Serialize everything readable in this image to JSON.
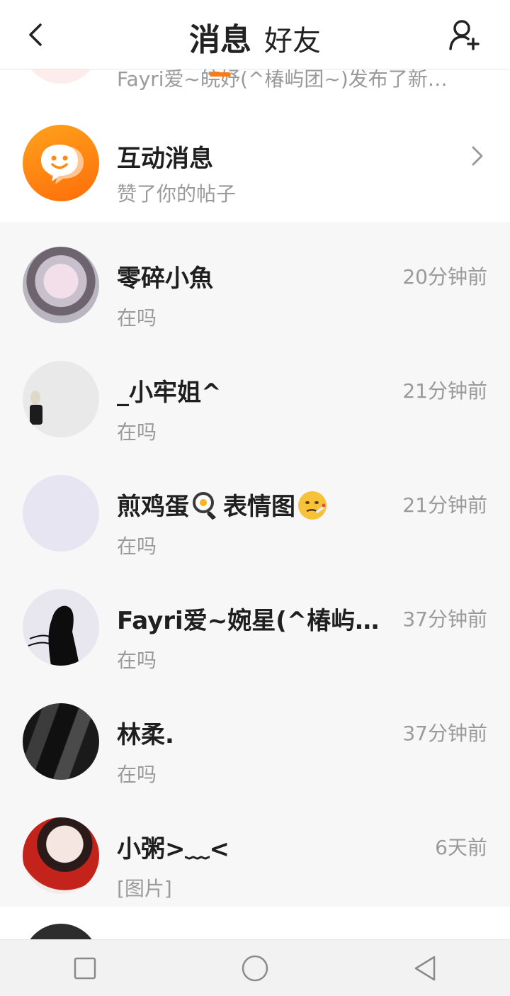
{
  "header": {
    "tabs": [
      {
        "label": "消息",
        "active": true
      },
      {
        "label": "好友",
        "active": false
      }
    ]
  },
  "top_item": {
    "preview": "Fayri爱~皖妤(^椿屿团~)发布了新…"
  },
  "interaction": {
    "name": "互动消息",
    "preview": "赞了你的帖子"
  },
  "conversations": [
    {
      "name": "零碎小魚",
      "preview": "在吗",
      "time": "20分钟前"
    },
    {
      "name": "_小牢姐^",
      "preview": "在吗",
      "time": "21分钟前"
    },
    {
      "name_before": "煎鸡蛋",
      "name_mid": "表情图",
      "preview": "在吗",
      "time": "21分钟前"
    },
    {
      "name": "Fayri爱~婉星(^椿屿团…",
      "preview": "在吗",
      "time": "37分钟前"
    },
    {
      "name": "林柔.",
      "preview": "在吗",
      "time": "37分钟前"
    },
    {
      "name": "小粥>﹏<",
      "preview": "[图片]",
      "time": "6天前"
    }
  ],
  "colors": {
    "accent": "#ff7a12",
    "list_bg": "#f7f7f7",
    "secondary_text": "#9a9a9a"
  },
  "icons": [
    "back-arrow-icon",
    "add-friend-icon",
    "chat-bubble-icon",
    "chevron-right-icon",
    "frying-pan-egg-icon",
    "sick-face-icon",
    "nav-square-icon",
    "nav-circle-icon",
    "nav-triangle-icon"
  ]
}
